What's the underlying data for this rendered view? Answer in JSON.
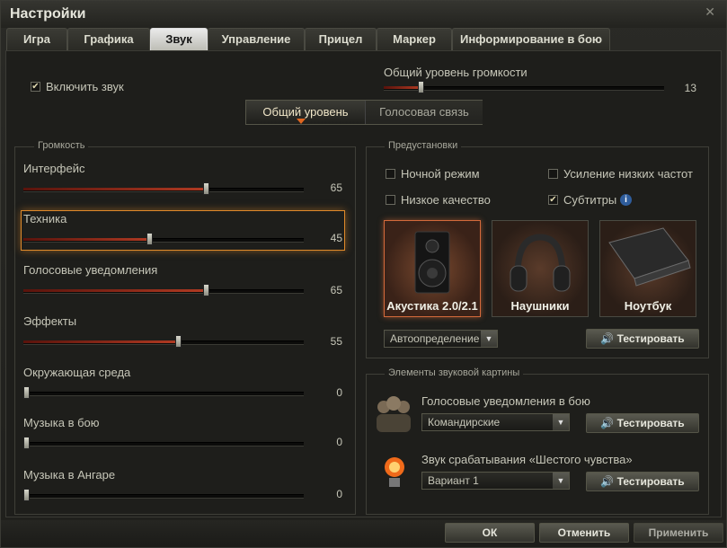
{
  "window": {
    "title": "Настройки"
  },
  "tabs": [
    {
      "label": "Игра"
    },
    {
      "label": "Графика"
    },
    {
      "label": "Звук"
    },
    {
      "label": "Управление"
    },
    {
      "label": "Прицел"
    },
    {
      "label": "Маркер"
    },
    {
      "label": "Информирование в бою"
    }
  ],
  "active_tab": "Звук",
  "enable_sound": {
    "label": "Включить звук",
    "checked": true
  },
  "master_volume": {
    "label": "Общий уровень громкости",
    "value": "13"
  },
  "mode_switch": {
    "general": "Общий уровень",
    "voice": "Голосовая связь",
    "active": "general"
  },
  "volume_group": {
    "title": "Громкость",
    "sliders": [
      {
        "label": "Интерфейс",
        "value": "65",
        "ratio": 0.65
      },
      {
        "label": "Техника",
        "value": "45",
        "ratio": 0.45
      },
      {
        "label": "Голосовые уведомления",
        "value": "65",
        "ratio": 0.65
      },
      {
        "label": "Эффекты",
        "value": "55",
        "ratio": 0.55
      },
      {
        "label": "Окружающая среда",
        "value": "0",
        "ratio": 0
      },
      {
        "label": "Музыка в бою",
        "value": "0",
        "ratio": 0
      },
      {
        "label": "Музыка в Ангаре",
        "value": "0",
        "ratio": 0
      }
    ],
    "highlighted": "Техника"
  },
  "presets": {
    "title": "Предустановки",
    "night_mode": {
      "label": "Ночной режим",
      "checked": false
    },
    "bass_boost": {
      "label": "Усиление низких частот",
      "checked": false
    },
    "low_quality": {
      "label": "Низкое качество",
      "checked": false
    },
    "subtitles": {
      "label": "Субтитры",
      "checked": true
    },
    "info_icon": "info-icon",
    "devices": [
      {
        "label": "Акустика 2.0/2.1",
        "icon": "speaker-icon",
        "active": true
      },
      {
        "label": "Наушники",
        "icon": "headphones-icon",
        "active": false
      },
      {
        "label": "Ноутбук",
        "icon": "laptop-icon",
        "active": false
      }
    ],
    "autodetect": "Автоопределение",
    "test_button": "Тестировать"
  },
  "sound_picture": {
    "title": "Элементы звуковой картины",
    "voice_notifications_label": "Голосовые уведомления в бою",
    "voice_notifications_value": "Командирские",
    "sixth_sense_label": "Звук срабатывания «Шестого чувства»",
    "sixth_sense_value": "Вариант 1",
    "test_button": "Тестировать"
  },
  "footer": {
    "ok": "ОК",
    "cancel": "Отменить",
    "apply": "Применить"
  },
  "colors": {
    "accent": "#e0661f",
    "highlight": "#e08a2a",
    "slider_fill": "#b03a22"
  }
}
